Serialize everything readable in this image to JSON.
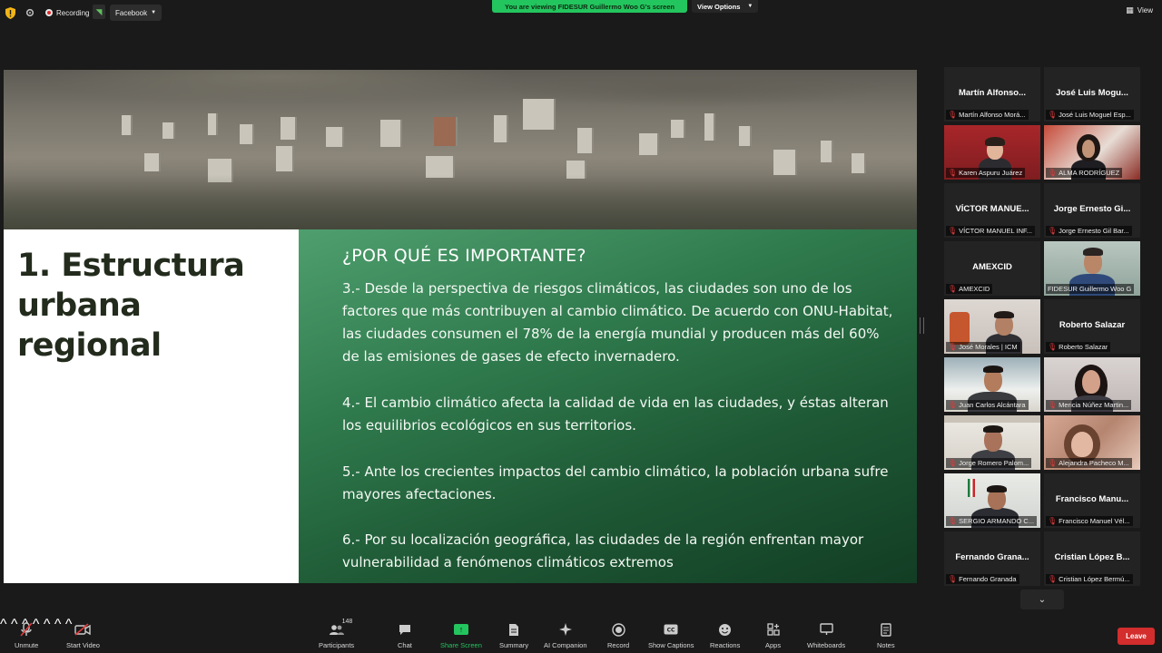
{
  "topbar": {
    "recording_label": "Recording",
    "live_label": "Facebook",
    "viewing_banner": "You are viewing FIDESUR Guillermo Woo G's screen",
    "view_options_label": "View Options",
    "view_label": "View"
  },
  "slide": {
    "title": "1. Estructura urbana regional",
    "heading": "¿POR QUÉ ES IMPORTANTE?",
    "paragraphs": [
      "3.- Desde la perspectiva de riesgos climáticos, las ciudades son uno de los factores que más contribuyen al cambio climático. De acuerdo con ONU-Habitat, las ciudades consumen el 78% de la energía mundial y producen más del 60% de las emisiones de gases de efecto invernadero.",
      "4.- El cambio climático afecta la calidad de vida en las ciudades, y éstas alteran los equilibrios ecológicos en sus territorios.",
      "5.- Ante los crecientes impactos del cambio climático, la población urbana sufre mayores afectaciones.",
      "6.- Por su localización geográfica, las ciudades de la región enfrentan mayor vulnerabilidad a fenómenos  climáticos extremos"
    ]
  },
  "participants": [
    {
      "display": "Martín Alfonso...",
      "label": "Martín Alfonso Morá..."
    },
    {
      "display": "José Luis Mogu...",
      "label": "José Luis Moguel Esp..."
    },
    {
      "display": "",
      "label": "Karen Aspuru Juárez"
    },
    {
      "display": "",
      "label": "ALMA RODRÍGUEZ"
    },
    {
      "display": "VÍCTOR MANUE...",
      "label": "VÍCTOR MANUEL INF..."
    },
    {
      "display": "Jorge Ernesto Gi...",
      "label": "Jorge Ernesto Gil Bar..."
    },
    {
      "display": "AMEXCID",
      "label": "AMEXCID"
    },
    {
      "display": "",
      "label": "FIDESUR Guillermo Woo G"
    },
    {
      "display": "",
      "label": "José Morales | ICM"
    },
    {
      "display": "Roberto Salazar",
      "label": "Roberto Salazar"
    },
    {
      "display": "",
      "label": "Juan Carlos Alcántara"
    },
    {
      "display": "",
      "label": "Mericia Núñez Martin..."
    },
    {
      "display": "",
      "label": "Jorge Romero Palom..."
    },
    {
      "display": "",
      "label": "Alejandra Pacheco M..."
    },
    {
      "display": "",
      "label": "SERGIO ARMANDO C..."
    },
    {
      "display": "Francisco Manu...",
      "label": "Francisco Manuel Vél..."
    },
    {
      "display": "Fernando Grana...",
      "label": "Fernando Granada"
    },
    {
      "display": "Cristian López B...",
      "label": "Cristian López Bermú..."
    }
  ],
  "toolbar": {
    "unmute": "Unmute",
    "start_video": "Start Video",
    "participants": "Participants",
    "participants_count": "148",
    "chat": "Chat",
    "share_screen": "Share Screen",
    "summary": "Summary",
    "ai_companion": "AI Companion",
    "record": "Record",
    "show_captions": "Show Captions",
    "reactions": "Reactions",
    "apps": "Apps",
    "whiteboards": "Whiteboards",
    "notes": "Notes",
    "leave": "Leave"
  },
  "icons": [
    "shield-icon",
    "gear-icon",
    "record-icon",
    "live-icon",
    "chevron-down-icon",
    "grid-view-icon",
    "mic-muted-icon",
    "video-off-icon",
    "participants-icon",
    "chat-icon",
    "share-screen-icon",
    "summary-icon",
    "ai-companion-icon",
    "record-button-icon",
    "captions-icon",
    "reactions-icon",
    "apps-icon",
    "whiteboards-icon",
    "notes-icon"
  ],
  "colors": {
    "accent_green": "#23c55e",
    "leave_red": "#d32d2d",
    "selected_outline": "#e6e85a",
    "slide_green": "#2f7a4d"
  }
}
